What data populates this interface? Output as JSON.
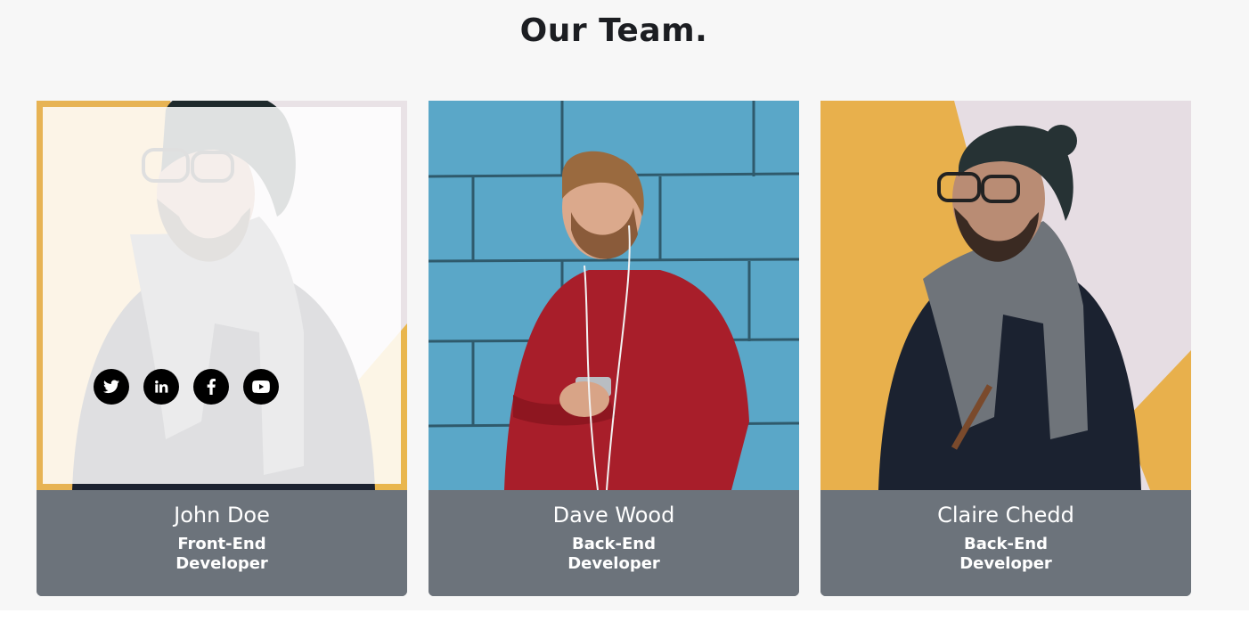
{
  "section": {
    "title": "Our Team."
  },
  "team": [
    {
      "name": "John Doe",
      "role_line1": "Front-End",
      "role_line2": "Developer",
      "photo": "man-in-beanie-and-scarf",
      "hover": true
    },
    {
      "name": "Dave Wood",
      "role_line1": "Back-End",
      "role_line2": "Developer",
      "photo": "man-in-red-sweater-with-earphones",
      "hover": false
    },
    {
      "name": "Claire Chedd",
      "role_line1": "Back-End",
      "role_line2": "Developer",
      "photo": "man-in-beanie-and-scarf",
      "hover": false
    }
  ],
  "social_icons": [
    "twitter-icon",
    "linkedin-icon",
    "facebook-icon",
    "youtube-icon"
  ],
  "colors": {
    "page_bg": "#f7f7f7",
    "card_footer": "#6c737b",
    "title": "#1c1e22",
    "social_button": "#000000"
  }
}
